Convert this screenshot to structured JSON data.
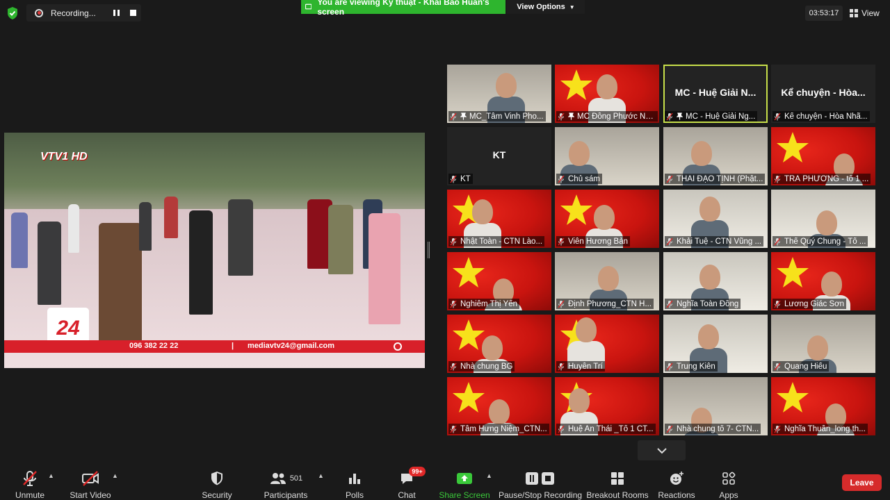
{
  "topbar": {
    "recording_label": "Recording...",
    "viewing_banner": "You are viewing Kỹ thuật - Khải Bảo Huấn's screen",
    "view_options_label": "View Options",
    "timer": "03:53:17",
    "view_label": "View"
  },
  "shared_screen": {
    "channel_logo": "VTV1 HD",
    "channel_badge": "24",
    "phone": "096 382 22 22",
    "separator": "|",
    "email": "mediavtv24@gmail.com"
  },
  "gallery": {
    "tiles": [
      {
        "name": "MC_Tâm Vinh Pho...",
        "pinned": true
      },
      {
        "name": "MC Đồng Phước Nghĩa",
        "pinned": true
      },
      {
        "name": "MC - Huệ Giải Ng...",
        "pinned": true,
        "big_name": "MC - Huệ Giải N..."
      },
      {
        "name": "Kể chuyện - Hòa Nhã...",
        "big_name": "Kể chuyện - Hòa..."
      },
      {
        "name": "KT",
        "big_name": "KT"
      },
      {
        "name": "Chủ sám"
      },
      {
        "name": "THÁI ĐẠO TỊNH (Phật..."
      },
      {
        "name": "TRÀ PHƯƠNG - tổ 1 ..."
      },
      {
        "name": "Nhật Toàn - CTN Lào..."
      },
      {
        "name": "Viên Hương Bản"
      },
      {
        "name": "Khải Tuệ - CTN Vũng ..."
      },
      {
        "name": "Thể Quý Chung - Tổ ..."
      },
      {
        "name": "Nghiêm Thị Yến"
      },
      {
        "name": "Định Phương_CTN H..."
      },
      {
        "name": "Nghĩa Toàn Đồng"
      },
      {
        "name": "Lương Giác Sơn"
      },
      {
        "name": "Nhà chung BG"
      },
      {
        "name": "Huyền Trí"
      },
      {
        "name": "Trung Kiên"
      },
      {
        "name": "Quang Hiếu"
      },
      {
        "name": "Tâm Hưng Niệm_CTN..."
      },
      {
        "name": "Huệ An Thái _Tổ 1 CT..."
      },
      {
        "name": "Nhà chung tổ 7- CTN..."
      },
      {
        "name": "Nghĩa Thuần_long th..."
      }
    ]
  },
  "toolbar": {
    "unmute": "Unmute",
    "start_video": "Start Video",
    "security": "Security",
    "participants": "Participants",
    "participants_count": "501",
    "polls": "Polls",
    "chat": "Chat",
    "chat_badge": "99+",
    "share_screen": "Share Screen",
    "pause_stop_recording": "Pause/Stop Recording",
    "breakout_rooms": "Breakout Rooms",
    "reactions": "Reactions",
    "apps": "Apps",
    "leave": "Leave"
  },
  "colors": {
    "share_green": "#2eb52e",
    "active_speaker": "#c8e04a",
    "leave_red": "#d62b2b",
    "flag_red": "#c9140f",
    "flag_star": "#f7e11b"
  }
}
